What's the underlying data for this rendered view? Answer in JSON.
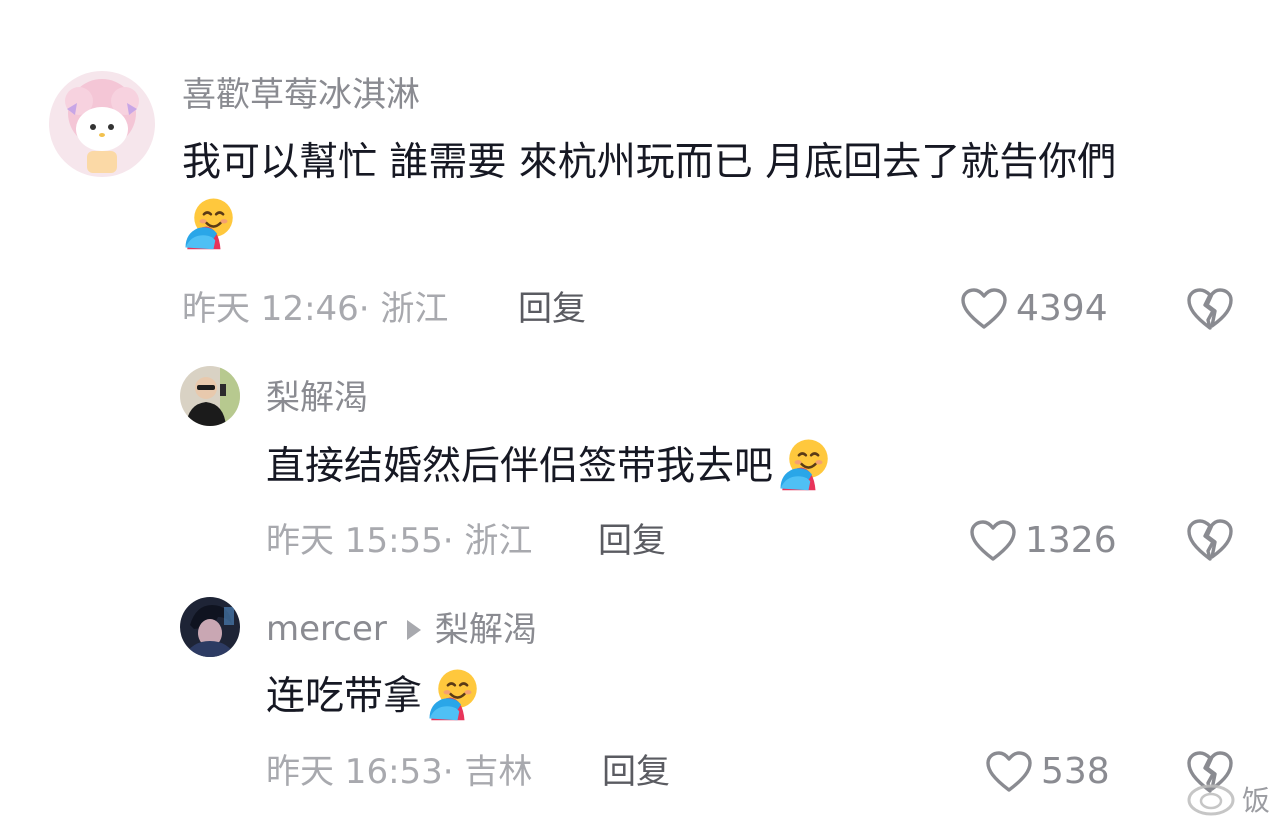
{
  "comments": [
    {
      "username": "喜歡草莓冰淇淋",
      "text": "我可以幫忙 誰需要 來杭州玩而已 月底回去了就告你們",
      "emoji": "hugging-face-emoji",
      "time": "昨天 12:46· 浙江",
      "reply_label": "回复",
      "likes": "4394"
    },
    {
      "username": "梨解渴",
      "text": "直接结婚然后伴侣签带我去吧",
      "emoji": "hugging-face-emoji",
      "time": "昨天 15:55· 浙江",
      "reply_label": "回复",
      "likes": "1326"
    },
    {
      "username": "mercer",
      "reply_to": "梨解渴",
      "text": "连吃带拿",
      "emoji": "hugging-face-emoji",
      "time": "昨天 16:53· 吉林",
      "reply_label": "回复",
      "likes": "538"
    }
  ],
  "watermark": {
    "text": "饭"
  },
  "colors": {
    "text": "#161823",
    "secondary": "#8a8b91",
    "meta": "#a8a9ae",
    "reply": "#5a5b61"
  }
}
